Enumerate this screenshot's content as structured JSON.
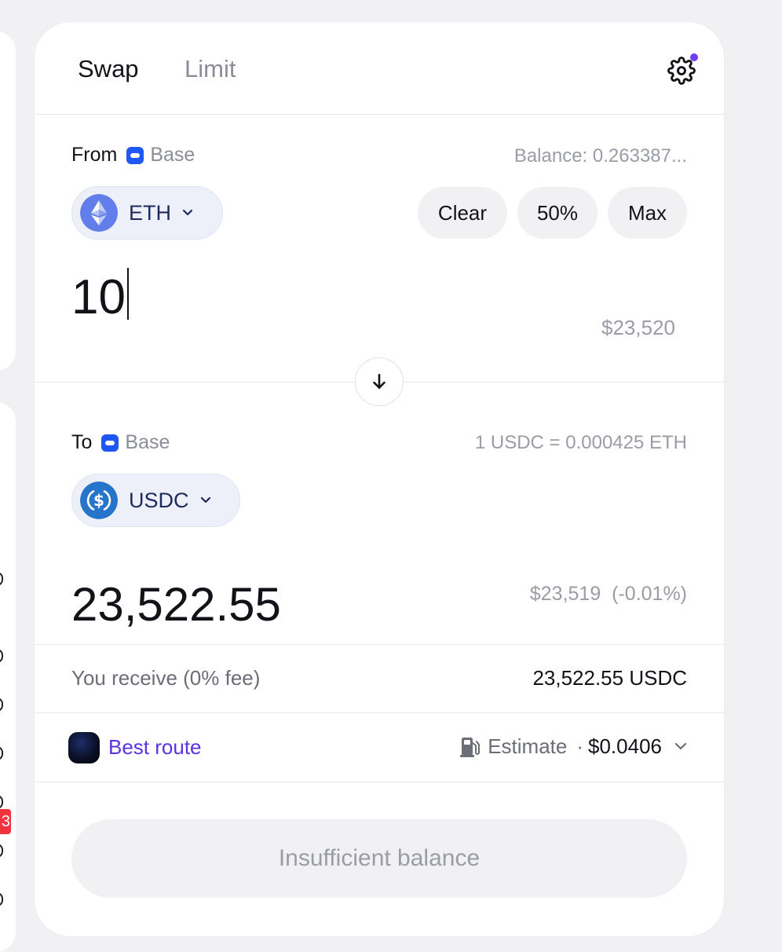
{
  "tabs": {
    "swap": "Swap",
    "limit": "Limit"
  },
  "from": {
    "label": "From",
    "chain": "Base",
    "balance": "Balance: 0.263387...",
    "token": "ETH",
    "token_icon": "ethereum-icon",
    "amount": "10",
    "usd_value": "$23,520",
    "buttons": {
      "clear": "Clear",
      "half": "50%",
      "max": "Max"
    }
  },
  "to": {
    "label": "To",
    "chain": "Base",
    "rate": "1 USDC = 0.000425 ETH",
    "token": "USDC",
    "token_icon": "usdc-icon",
    "amount": "23,522.55",
    "usd_value": "$23,519  (-0.01%)"
  },
  "receive": {
    "label": "You receive (0% fee)",
    "value": "23,522.55 USDC"
  },
  "route": {
    "label": "Best route",
    "estimate_label": "Estimate",
    "separator": "·",
    "estimate_value": "$0.0406"
  },
  "cta": {
    "label": "Insufficient balance"
  },
  "colors": {
    "accent": "#5a32e6",
    "notification_dot": "#6f3cf5",
    "chain_blue": "#1f57f5",
    "eth_purple": "#627eea",
    "usdc_blue": "#2775ca"
  },
  "edge": {
    "badge": "3"
  }
}
